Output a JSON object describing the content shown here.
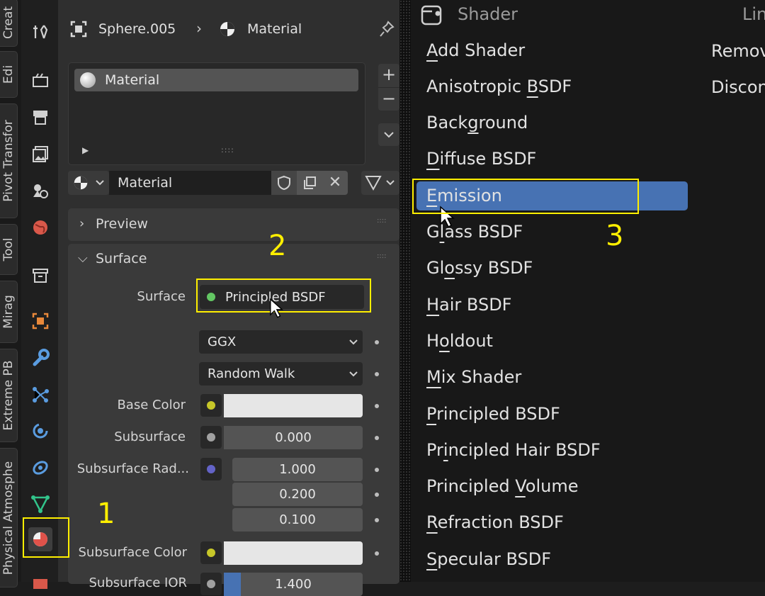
{
  "vtabs": [
    "Creat",
    "Edi",
    "Pivot Transfor",
    "Tool",
    "Mirag",
    "Extreme PB",
    "Physical Atmosphe"
  ],
  "header": {
    "object_name": "Sphere.005",
    "context_label": "Material"
  },
  "material_slot": {
    "name": "Material"
  },
  "datablock": {
    "name": "Material"
  },
  "panels": {
    "preview": "Preview",
    "surface": "Surface"
  },
  "surface": {
    "surface_label": "Surface",
    "surface_value": "Principled BSDF",
    "distribution": "GGX",
    "subsurface_method": "Random Walk",
    "base_color_label": "Base Color",
    "subsurface_label": "Subsurface",
    "subsurface_value": "0.000",
    "subsurface_radius_label": "Subsurface Rad...",
    "radius_values": [
      "1.000",
      "0.200",
      "0.100"
    ],
    "subsurface_color_label": "Subsurface Color",
    "subsurface_ior_label": "Subsurface IOR",
    "subsurface_ior_value": "1.400"
  },
  "annotations": [
    "1",
    "2",
    "3"
  ],
  "menu": {
    "title": "Shader",
    "right_title": "Lin",
    "right_items": [
      "Remov",
      "Discon"
    ],
    "items": [
      {
        "pre": "",
        "u": "A",
        "post": "dd Shader"
      },
      {
        "pre": "Anisotropic ",
        "u": "B",
        "post": "SDF"
      },
      {
        "pre": "Back",
        "u": "g",
        "post": "round"
      },
      {
        "pre": "",
        "u": "D",
        "post": "iffuse BSDF"
      },
      {
        "pre": "",
        "u": "E",
        "post": "mission"
      },
      {
        "pre": "G",
        "u": "l",
        "post": "ass BSDF"
      },
      {
        "pre": "Gl",
        "u": "o",
        "post": "ssy BSDF"
      },
      {
        "pre": "",
        "u": "H",
        "post": "air BSDF"
      },
      {
        "pre": "H",
        "u": "o",
        "post": "ldout"
      },
      {
        "pre": "",
        "u": "M",
        "post": "ix Shader"
      },
      {
        "pre": "",
        "u": "P",
        "post": "rincipled BSDF"
      },
      {
        "pre": "Pr",
        "u": "i",
        "post": "ncipled Hair BSDF"
      },
      {
        "pre": "Principled ",
        "u": "V",
        "post": "olume"
      },
      {
        "pre": "",
        "u": "R",
        "post": "efraction BSDF"
      },
      {
        "pre": "",
        "u": "S",
        "post": "pecular BSDF"
      }
    ]
  },
  "colors": {
    "accent_blue": "#4772b3",
    "highlight_yellow": "#ffef00",
    "socket_green": "#63c763",
    "socket_yellow": "#c7c729",
    "socket_gray": "#a1a1a1",
    "socket_purple": "#6363c7"
  }
}
